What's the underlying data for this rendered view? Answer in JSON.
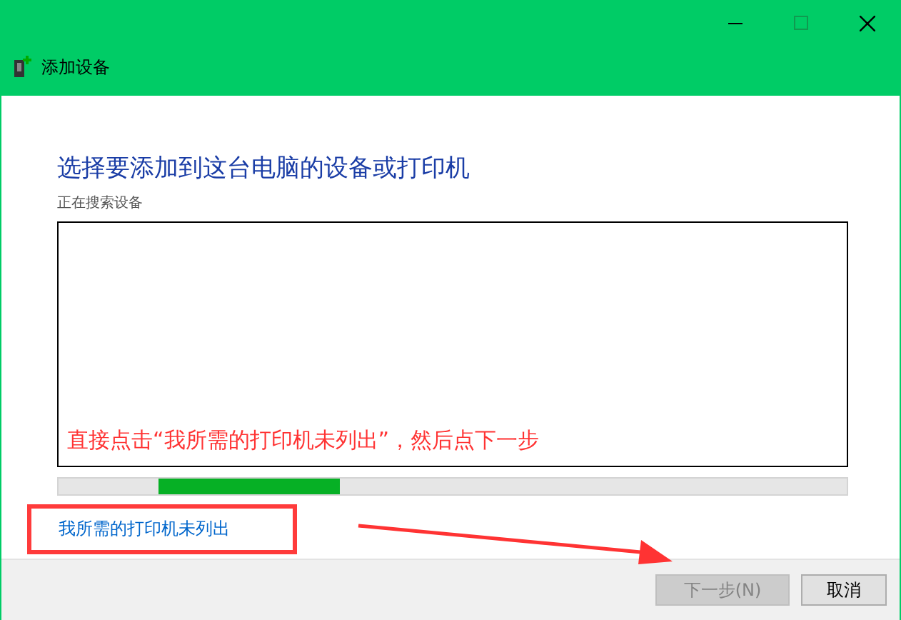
{
  "window": {
    "title": "添加设备"
  },
  "heading": "选择要添加到这台电脑的设备或打印机",
  "status": "正在搜索设备",
  "annotation": "直接点击“我所需的打印机未列出”，然后点下一步",
  "progress": {
    "level": 0.23
  },
  "link": "我所需的打印机未列出",
  "buttons": [
    {
      "label": "下一步(N)",
      "disabled": true
    },
    {
      "label": "取消",
      "disabled": false
    }
  ]
}
